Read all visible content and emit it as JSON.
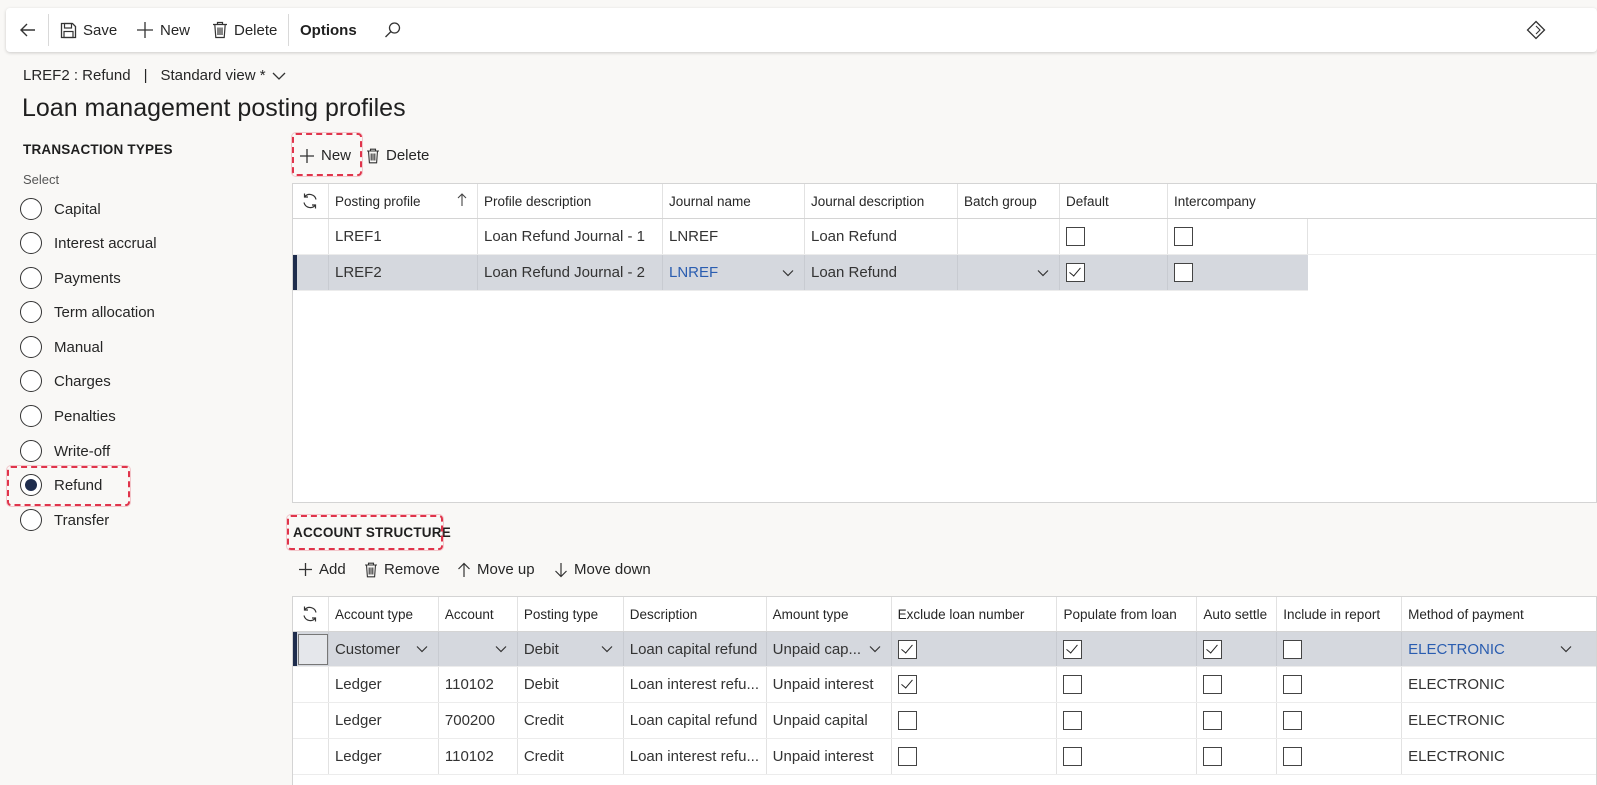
{
  "actionpane": {
    "save": "Save",
    "new": "New",
    "delete": "Delete",
    "options": "Options"
  },
  "breadcrumb": {
    "record": "LREF2 : Refund",
    "separator": "|",
    "view": "Standard view *"
  },
  "page_title": "Loan management posting profiles",
  "transaction_types": {
    "heading": "TRANSACTION TYPES",
    "select_label": "Select",
    "options": [
      "Capital",
      "Interest accrual",
      "Payments",
      "Term allocation",
      "Manual",
      "Charges",
      "Penalties",
      "Write-off",
      "Refund",
      "Transfer"
    ],
    "selected": "Refund"
  },
  "profiles_toolbar": {
    "new": "New",
    "delete": "Delete"
  },
  "profiles_grid": {
    "columns": [
      "Posting profile",
      "Profile description",
      "Journal name",
      "Journal description",
      "Batch group",
      "Default",
      "Intercompany"
    ],
    "rows": [
      {
        "profile": "LREF1",
        "description": "Loan Refund Journal - 1",
        "journal": "LNREF",
        "journal_description": "Loan Refund",
        "batch_group": "",
        "default": false,
        "intercompany": false
      },
      {
        "profile": "LREF2",
        "description": "Loan Refund Journal - 2",
        "journal": "LNREF",
        "journal_description": "Loan Refund",
        "batch_group": "",
        "default": true,
        "intercompany": false
      }
    ]
  },
  "account_structure": {
    "heading": "ACCOUNT STRUCTURE",
    "toolbar": {
      "add": "Add",
      "remove": "Remove",
      "move_up": "Move up",
      "move_down": "Move down"
    },
    "columns": [
      "Account type",
      "Account",
      "Posting type",
      "Description",
      "Amount type",
      "Exclude loan number",
      "Populate from loan",
      "Auto settle",
      "Include in report",
      "Method of payment"
    ],
    "rows": [
      {
        "account_type": "Customer",
        "account": "",
        "posting_type": "Debit",
        "description": "Loan capital refund",
        "amount_type": "Unpaid cap...",
        "exclude": true,
        "populate": true,
        "auto_settle": true,
        "include": false,
        "method": "ELECTRONIC"
      },
      {
        "account_type": "Ledger",
        "account": "110102",
        "posting_type": "Debit",
        "description": "Loan interest refu...",
        "amount_type": "Unpaid interest",
        "exclude": true,
        "populate": false,
        "auto_settle": false,
        "include": false,
        "method": "ELECTRONIC"
      },
      {
        "account_type": "Ledger",
        "account": "700200",
        "posting_type": "Credit",
        "description": "Loan capital refund",
        "amount_type": "Unpaid capital",
        "exclude": false,
        "populate": false,
        "auto_settle": false,
        "include": false,
        "method": "ELECTRONIC"
      },
      {
        "account_type": "Ledger",
        "account": "110102",
        "posting_type": "Credit",
        "description": "Loan interest refu...",
        "amount_type": "Unpaid interest",
        "exclude": false,
        "populate": false,
        "auto_settle": false,
        "include": false,
        "method": "ELECTRONIC"
      }
    ]
  },
  "colors": {
    "highlight": "#e0344b",
    "selected_row": "#d5d8de",
    "link": "#2a5db0",
    "selection_bar": "#1f2d4d"
  }
}
